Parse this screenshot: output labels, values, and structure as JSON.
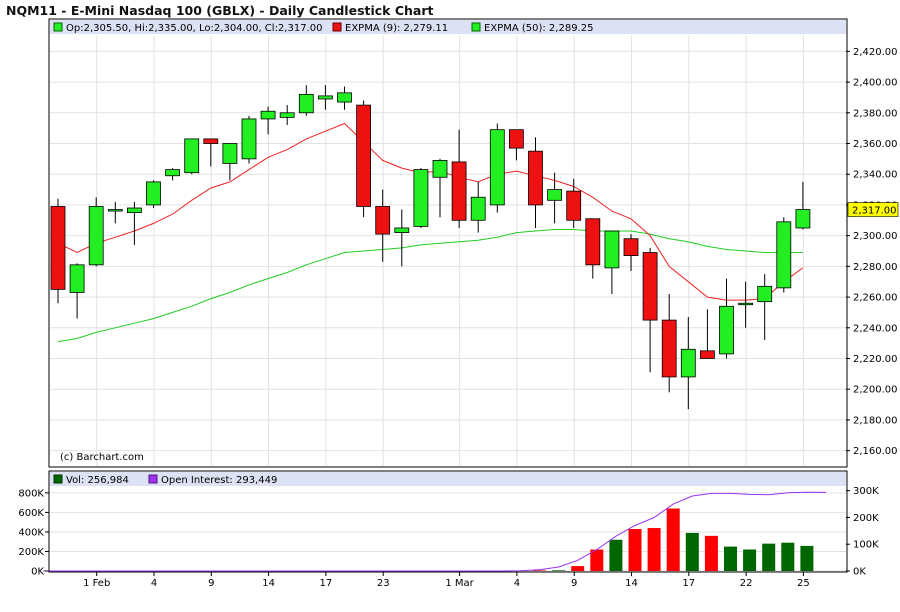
{
  "chart_data": [
    {
      "type": "candlestick",
      "title": "NQM11 - E-Mini Nasdaq 100 (GBLX) - Daily Candlestick Chart",
      "legend": {
        "ohlc": "Op:2,305.50, Hi:2,335.00, Lo:2,304.00, Cl:2,317.00",
        "ema9": "EXPMA (9): 2,279.11",
        "ema50": "EXPMA (50): 2,289.25"
      },
      "colors": {
        "up": "#22ee22",
        "down": "#ee1111",
        "ema9": "#ee2222",
        "ema50": "#22cc22",
        "legend_bg": "#dde1f4",
        "axis_box": "#ffff00",
        "grid": "#dddddd"
      },
      "ylim": [
        2150,
        2430
      ],
      "y_ticks": [
        "2,160.00",
        "2,180.00",
        "2,200.00",
        "2,220.00",
        "2,240.00",
        "2,260.00",
        "2,280.00",
        "2,300.00",
        "2,320.00",
        "2,340.00",
        "2,360.00",
        "2,380.00",
        "2,400.00",
        "2,420.00"
      ],
      "last_price_label": "2,317.00",
      "last_price": 2317,
      "watermark": "(c) Barchart.com",
      "candles": [
        {
          "o": 2319,
          "h": 2324,
          "l": 2256,
          "c": 2265
        },
        {
          "o": 2263,
          "h": 2282,
          "l": 2246,
          "c": 2281
        },
        {
          "o": 2281,
          "h": 2325,
          "l": 2280,
          "c": 2319
        },
        {
          "o": 2316,
          "h": 2322,
          "l": 2308,
          "c": 2317
        },
        {
          "o": 2315,
          "h": 2322,
          "l": 2294,
          "c": 2318
        },
        {
          "o": 2320,
          "h": 2336,
          "l": 2318,
          "c": 2335
        },
        {
          "o": 2339,
          "h": 2344,
          "l": 2336,
          "c": 2343
        },
        {
          "o": 2341,
          "h": 2362,
          "l": 2340,
          "c": 2363
        },
        {
          "o": 2363,
          "h": 2362,
          "l": 2345,
          "c": 2360
        },
        {
          "o": 2347,
          "h": 2360,
          "l": 2336,
          "c": 2360
        },
        {
          "o": 2350,
          "h": 2378,
          "l": 2347,
          "c": 2376
        },
        {
          "o": 2376,
          "h": 2384,
          "l": 2366,
          "c": 2381
        },
        {
          "o": 2377,
          "h": 2385,
          "l": 2372,
          "c": 2380
        },
        {
          "o": 2380,
          "h": 2398,
          "l": 2378,
          "c": 2392
        },
        {
          "o": 2389,
          "h": 2398,
          "l": 2382,
          "c": 2391
        },
        {
          "o": 2387,
          "h": 2397,
          "l": 2382,
          "c": 2393
        },
        {
          "o": 2385,
          "h": 2388,
          "l": 2312,
          "c": 2319
        },
        {
          "o": 2319,
          "h": 2330,
          "l": 2283,
          "c": 2301
        },
        {
          "o": 2302,
          "h": 2317,
          "l": 2280,
          "c": 2305
        },
        {
          "o": 2306,
          "h": 2344,
          "l": 2305,
          "c": 2343
        },
        {
          "o": 2338,
          "h": 2350,
          "l": 2312,
          "c": 2349
        },
        {
          "o": 2348,
          "h": 2369,
          "l": 2305,
          "c": 2310
        },
        {
          "o": 2310,
          "h": 2335,
          "l": 2302,
          "c": 2325
        },
        {
          "o": 2320,
          "h": 2373,
          "l": 2315,
          "c": 2369
        },
        {
          "o": 2369,
          "h": 2367,
          "l": 2349,
          "c": 2357
        },
        {
          "o": 2355,
          "h": 2364,
          "l": 2305,
          "c": 2320
        },
        {
          "o": 2323,
          "h": 2341,
          "l": 2308,
          "c": 2330
        },
        {
          "o": 2329,
          "h": 2337,
          "l": 2305,
          "c": 2310
        },
        {
          "o": 2311,
          "h": 2311,
          "l": 2272,
          "c": 2281
        },
        {
          "o": 2279,
          "h": 2303,
          "l": 2262,
          "c": 2303
        },
        {
          "o": 2298,
          "h": 2301,
          "l": 2277,
          "c": 2287
        },
        {
          "o": 2289,
          "h": 2292,
          "l": 2211,
          "c": 2245
        },
        {
          "o": 2245,
          "h": 2262,
          "l": 2198,
          "c": 2208
        },
        {
          "o": 2208,
          "h": 2247,
          "l": 2187,
          "c": 2226
        },
        {
          "o": 2225,
          "h": 2252,
          "l": 2220,
          "c": 2220
        },
        {
          "o": 2223,
          "h": 2272,
          "l": 2220,
          "c": 2254
        },
        {
          "o": 2256,
          "h": 2270,
          "l": 2240,
          "c": 2256
        },
        {
          "o": 2257,
          "h": 2275,
          "l": 2232,
          "c": 2267
        },
        {
          "o": 2266,
          "h": 2312,
          "l": 2263,
          "c": 2309
        },
        {
          "o": 2305,
          "h": 2335,
          "l": 2304,
          "c": 2317
        }
      ],
      "ema9": [
        2295,
        2289,
        2295,
        2299,
        2303,
        2308,
        2314,
        2323,
        2331,
        2335,
        2343,
        2351,
        2356,
        2363,
        2368,
        2373,
        2361,
        2349,
        2344,
        2341,
        2342,
        2338,
        2335,
        2340,
        2342,
        2339,
        2336,
        2332,
        2325,
        2316,
        2311,
        2300,
        2280,
        2270,
        2260,
        2258,
        2258,
        2259,
        2270,
        2279
      ],
      "ema50": [
        2231,
        2233,
        2237,
        2240,
        2243,
        2246,
        2250,
        2254,
        2259,
        2263,
        2268,
        2272,
        2276,
        2281,
        2285,
        2289,
        2290,
        2291,
        2292,
        2294,
        2295,
        2296,
        2297,
        2299,
        2302,
        2303,
        2304,
        2304,
        2303,
        2303,
        2303,
        2301,
        2298,
        2296,
        2293,
        2291,
        2290,
        2289,
        2289,
        2289
      ]
    },
    {
      "type": "bar",
      "legend": {
        "volume": "Vol: 256,984",
        "open_interest": "Open Interest: 293,449"
      },
      "colors": {
        "up": "#006600",
        "down": "#ff0000",
        "oi": "#9933ee"
      },
      "y_left_ticks": [
        "0K",
        "200K",
        "400K",
        "600K",
        "800K"
      ],
      "y_right_ticks": [
        "0K",
        "100K",
        "200K",
        "300K"
      ],
      "volume_ylim": [
        0,
        850000
      ],
      "oi_ylim": [
        0,
        310000
      ],
      "volume": [
        0,
        0,
        0,
        0,
        0,
        0,
        0,
        0,
        0,
        0,
        0,
        0,
        0,
        0,
        0,
        0,
        0,
        0,
        0,
        0,
        0,
        0,
        0,
        0,
        0,
        5000,
        6000,
        7000,
        50000,
        220000,
        320000,
        430000,
        440000,
        640000,
        390000,
        360000,
        250000,
        220000,
        280000,
        290000,
        257000
      ],
      "open_interest": [
        0,
        0,
        0,
        0,
        0,
        0,
        0,
        0,
        0,
        0,
        0,
        0,
        0,
        0,
        0,
        0,
        0,
        0,
        0,
        0,
        0,
        0,
        0,
        0,
        0,
        1000,
        5000,
        15000,
        40000,
        80000,
        130000,
        170000,
        200000,
        250000,
        280000,
        290000,
        290000,
        286000,
        285000,
        292000,
        294000,
        293449
      ]
    }
  ],
  "x_axis": {
    "labels": [
      {
        "text": "1 Feb",
        "i": 2
      },
      {
        "text": "4",
        "i": 5
      },
      {
        "text": "9",
        "i": 8
      },
      {
        "text": "14",
        "i": 11
      },
      {
        "text": "17",
        "i": 14
      },
      {
        "text": "23",
        "i": 17
      },
      {
        "text": "1 Mar",
        "i": 21
      },
      {
        "text": "4",
        "i": 24
      },
      {
        "text": "9",
        "i": 27
      },
      {
        "text": "14",
        "i": 30
      },
      {
        "text": "17",
        "i": 33
      },
      {
        "text": "22",
        "i": 36
      },
      {
        "text": "25",
        "i": 39
      }
    ]
  }
}
